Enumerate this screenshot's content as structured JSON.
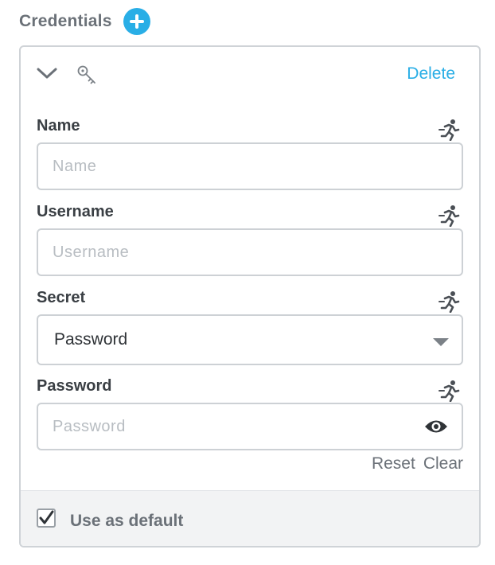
{
  "section": {
    "title": "Credentials",
    "add_icon": "plus-circle-icon",
    "accent_color": "#29aee6"
  },
  "credential": {
    "collapse_icon": "chevron-down-icon",
    "type_icon": "key-icon",
    "delete_label": "Delete",
    "fields": {
      "name": {
        "label": "Name",
        "placeholder": "Name",
        "value": "",
        "action_icon": "run-icon"
      },
      "username": {
        "label": "Username",
        "placeholder": "Username",
        "value": "",
        "action_icon": "run-icon"
      },
      "secret": {
        "label": "Secret",
        "selected": "Password",
        "action_icon": "run-icon"
      },
      "password": {
        "label": "Password",
        "placeholder": "Password",
        "value": "",
        "action_icon": "run-icon",
        "reveal_icon": "eye-icon"
      }
    },
    "reset_label": "Reset",
    "clear_label": "Clear",
    "default_checkbox": {
      "label": "Use as default",
      "checked": true
    }
  }
}
